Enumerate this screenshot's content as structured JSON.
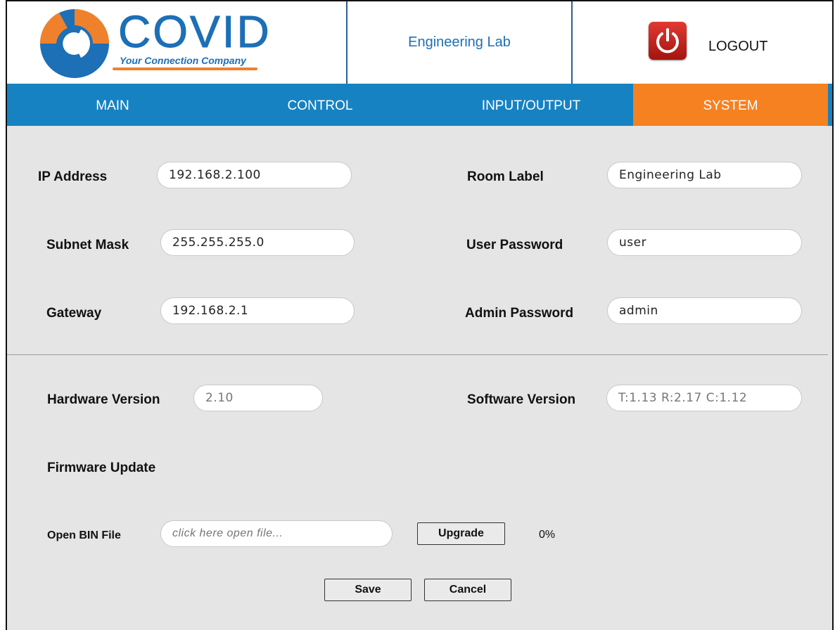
{
  "header": {
    "logo_word": "COVID",
    "logo_tagline": "Your Connection Company",
    "room": "Engineering Lab",
    "logout_label": "LOGOUT"
  },
  "nav": {
    "tabs": [
      "MAIN",
      "CONTROL",
      "INPUT/OUTPUT",
      "SYSTEM"
    ],
    "active": "SYSTEM"
  },
  "network": {
    "ip_label": "IP Address",
    "ip_value": "192.168.2.100",
    "subnet_label": "Subnet Mask",
    "subnet_value": "255.255.255.0",
    "gateway_label": "Gateway",
    "gateway_value": "192.168.2.1"
  },
  "settings": {
    "room_label": "Room Label",
    "room_value": "Engineering Lab",
    "user_pw_label": "User Password",
    "user_pw_value": "user",
    "admin_pw_label": "Admin Password",
    "admin_pw_value": "admin"
  },
  "versions": {
    "hw_label": "Hardware Version",
    "hw_value": "2.10",
    "sw_label": "Software Version",
    "sw_value": "T:1.13 R:2.17 C:1.12"
  },
  "firmware": {
    "title": "Firmware Update",
    "open_label": "Open BIN File",
    "file_placeholder": "click here open file...",
    "upgrade_label": "Upgrade",
    "progress_text": "0%"
  },
  "actions": {
    "save_label": "Save",
    "cancel_label": "Cancel"
  },
  "colors": {
    "nav_blue": "#1782c2",
    "active_orange": "#f68121",
    "brand_blue": "#1d6fb6",
    "power_red": "#c4221b"
  },
  "icons": {
    "logo": "covid-logo-icon",
    "logout": "power-icon"
  }
}
